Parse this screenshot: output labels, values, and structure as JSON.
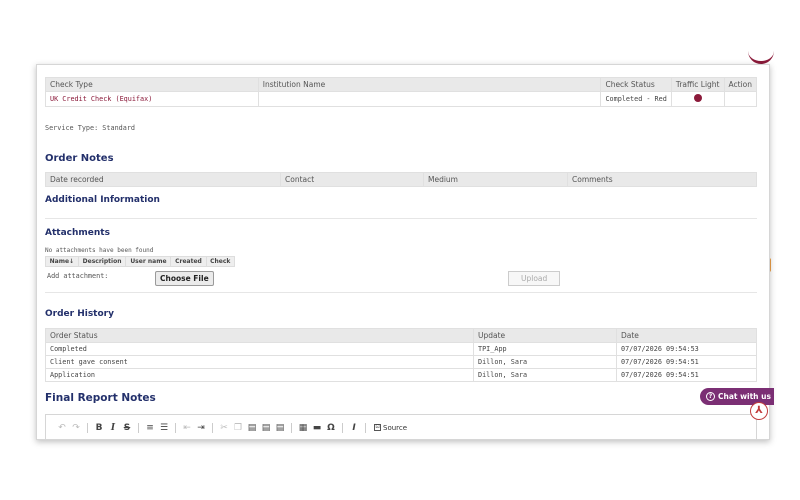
{
  "checks_table": {
    "headers": [
      "Check Type",
      "Institution Name",
      "Check Status",
      "Traffic Light",
      "Action"
    ],
    "rows": [
      {
        "check_type": "UK Credit Check (Equifax)",
        "institution": "",
        "status": "Completed - Red",
        "traffic_light": "red",
        "action": ""
      }
    ]
  },
  "service_type": "Service Type: Standard",
  "order_notes": {
    "title": "Order Notes",
    "headers": [
      "Date recorded",
      "Contact",
      "Medium",
      "Comments"
    ]
  },
  "additional_info": {
    "title": "Additional Information"
  },
  "attachments": {
    "title": "Attachments",
    "empty_text": "No attachments have been found",
    "headers": [
      "Name↓",
      "Description",
      "User name",
      "Created",
      "Check"
    ],
    "add_label": "Add attachment:",
    "choose_file_label": "Choose File",
    "upload_label": "Upload"
  },
  "order_history": {
    "title": "Order History",
    "headers": [
      "Order Status",
      "Update",
      "Date"
    ],
    "rows": [
      {
        "status": "Completed",
        "update": "TPI_App",
        "date": "07/07/2026 09:54:53"
      },
      {
        "status": "Client gave consent",
        "update": "Dillon, Sara",
        "date": "07/07/2026 09:54:51"
      },
      {
        "status": "Application",
        "update": "Dillon, Sara",
        "date": "07/07/2026 09:54:51"
      }
    ]
  },
  "final_report": {
    "title": "Final Report Notes",
    "source_label": "Source"
  },
  "chat": {
    "label": "Chat with us"
  },
  "colors": {
    "accent": "#8b1a3a",
    "heading": "#23306b",
    "chat": "#7b2f74"
  }
}
